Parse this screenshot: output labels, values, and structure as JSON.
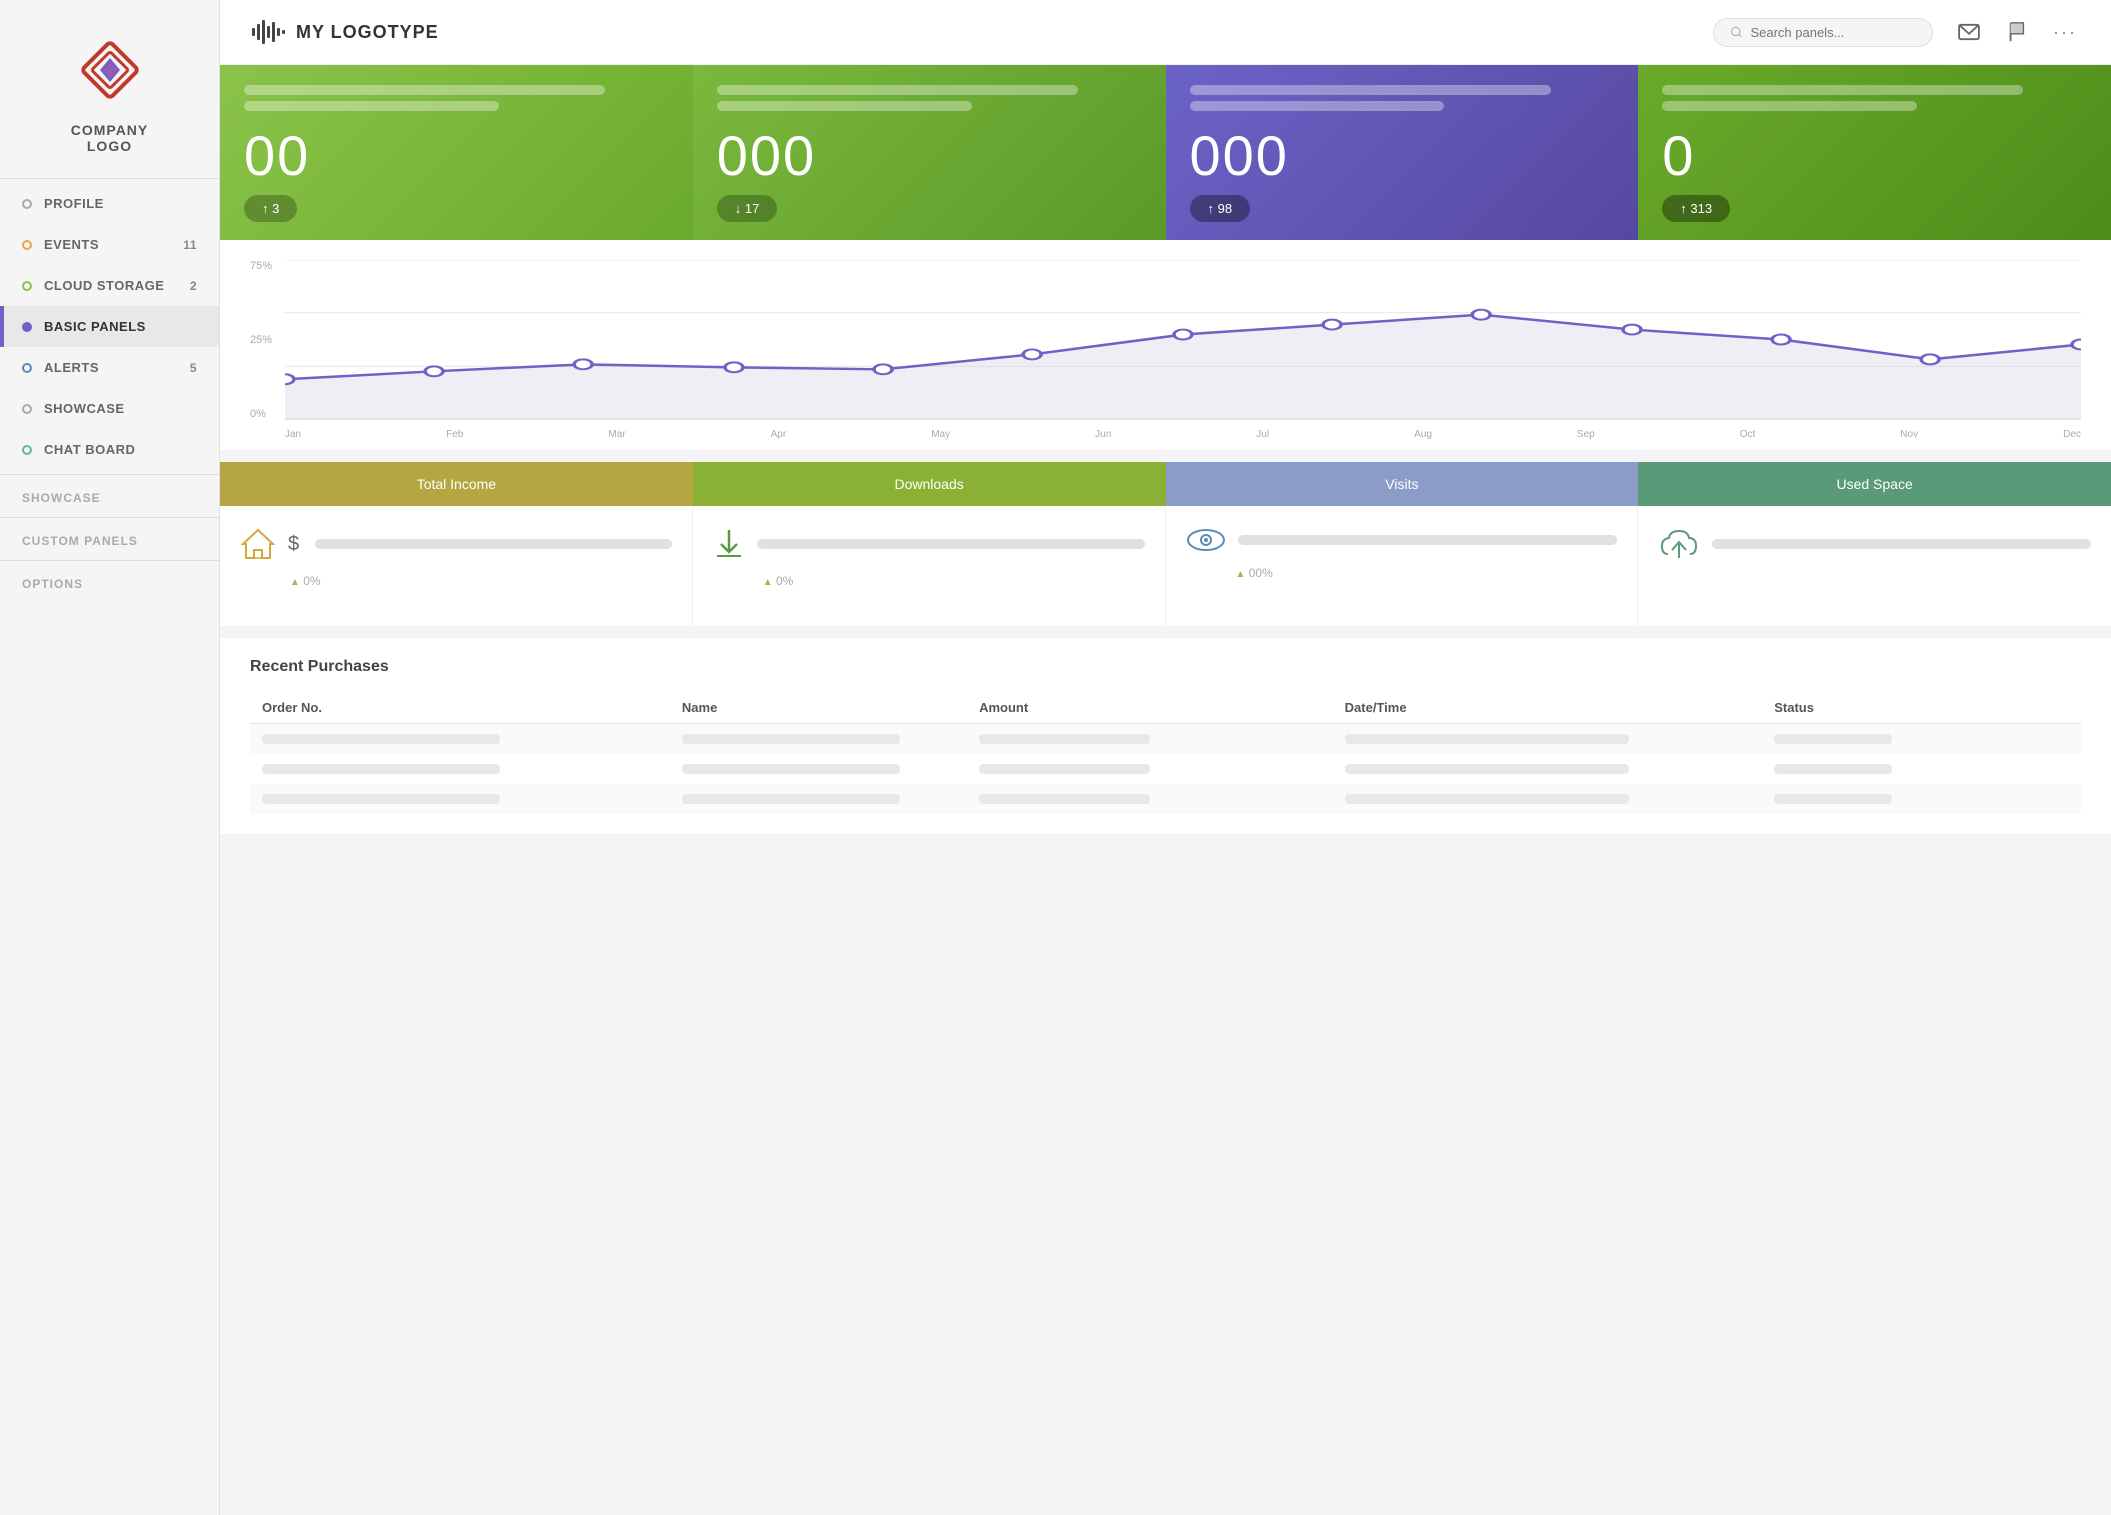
{
  "header": {
    "logo_icon": "waveform",
    "title": "MY LOGOTYPE",
    "search_placeholder": "Search panels..."
  },
  "sidebar": {
    "company_name": "COMPANY\nLOGO",
    "nav_items": [
      {
        "id": "profile",
        "label": "PROFILE",
        "dot": "default",
        "badge": ""
      },
      {
        "id": "events",
        "label": "EVENTS",
        "dot": "orange",
        "badge": "11"
      },
      {
        "id": "cloud-storage",
        "label": "CLOUD STORAGE",
        "dot": "green",
        "badge": "2"
      },
      {
        "id": "basic-panels",
        "label": "BASIC PANELS",
        "dot": "purple",
        "badge": "",
        "active": true
      },
      {
        "id": "alerts",
        "label": "ALERTS",
        "dot": "blue",
        "badge": "5"
      },
      {
        "id": "showcase",
        "label": "SHOWCASE",
        "dot": "default",
        "badge": ""
      },
      {
        "id": "chat-board",
        "label": "CHAT BOARD",
        "dot": "cyan",
        "badge": ""
      }
    ],
    "section_labels": [
      "SHOWCASE",
      "CUSTOM PANELS",
      "OPTIONS"
    ]
  },
  "stats": [
    {
      "id": "stat1",
      "number": "00",
      "badge": "↑ 3",
      "dark": false
    },
    {
      "id": "stat2",
      "number": "000",
      "badge": "↓ 17",
      "dark": false
    },
    {
      "id": "stat3",
      "number": "000",
      "badge": "↑ 98",
      "dark": true
    },
    {
      "id": "stat4",
      "number": "0",
      "badge": "↑ 313",
      "dark": true
    }
  ],
  "chart": {
    "y_labels": [
      "75%",
      "25%",
      "0%"
    ],
    "x_labels": [
      "Jan",
      "Feb",
      "Mar",
      "Apr",
      "May",
      "Jun",
      "Jul",
      "Aug",
      "Sep",
      "Oct",
      "Nov",
      "Dec"
    ]
  },
  "metrics": {
    "headers": [
      "Total Income",
      "Downloads",
      "Visits",
      "Used Space"
    ],
    "items": [
      {
        "icon": "house",
        "percent": "▲ 0%"
      },
      {
        "icon": "download",
        "percent": "▲ 0%"
      },
      {
        "icon": "eye",
        "percent": "▲ 00%"
      },
      {
        "icon": "cloud",
        "percent": ""
      }
    ]
  },
  "table": {
    "title": "Recent Purchases",
    "columns": [
      "Order No.",
      "Name",
      "Amount",
      "Date/Time",
      "Status"
    ],
    "rows": [
      {
        "order": "",
        "name": "",
        "amount": "",
        "datetime": "",
        "status": ""
      },
      {
        "order": "",
        "name": "",
        "amount": "",
        "datetime": "",
        "status": ""
      },
      {
        "order": "",
        "name": "",
        "amount": "",
        "datetime": "",
        "status": ""
      }
    ]
  }
}
